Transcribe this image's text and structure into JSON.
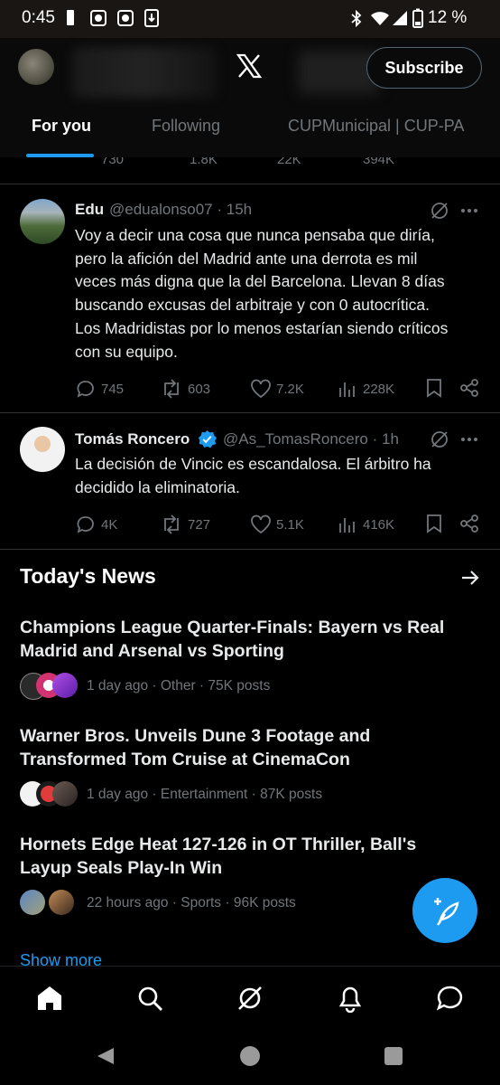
{
  "status_bar": {
    "time": "0:45",
    "battery": "12 %"
  },
  "header": {
    "logo": "x-logo-icon",
    "subscribe_label": "Subscribe"
  },
  "tabs": [
    {
      "label": "For you"
    },
    {
      "label": "Following"
    },
    {
      "label": "CUPMunicipal | CUP-PA"
    }
  ],
  "partial_row": {
    "replies": "730",
    "reposts": "1.8K",
    "likes": "22K",
    "views": "394K"
  },
  "tweets": [
    {
      "name": "Edu",
      "handle": "@edualonso07",
      "time": "· 15h",
      "verified": false,
      "lines": [
        "Voy a decir una cosa que nunca pensaba que diría,",
        "pero la afición del Madrid ante una derrota es mil",
        "veces más digna que la del Barcelona. Llevan 8 días",
        "buscando excusas del arbitraje y con 0 autocrítica.",
        "Los Madridistas por lo menos estarían siendo críticos",
        "con su equipo."
      ],
      "replies": "745",
      "reposts": "603",
      "likes": "7.2K",
      "views": "228K"
    },
    {
      "name": "Tomás Roncero",
      "handle": "@As_TomasRoncero",
      "time": "· 1h",
      "verified": true,
      "lines": [
        "La decisión de Vincic es escandalosa. El árbitro ha",
        "decidido la eliminatoria."
      ],
      "replies": "4K",
      "reposts": "727",
      "likes": "5.1K",
      "views": "416K"
    }
  ],
  "news": {
    "heading": "Today's News",
    "items": [
      {
        "title_lines": [
          "Champions League Quarter-Finals: Bayern vs Real",
          "Madrid and Arsenal vs Sporting"
        ],
        "meta": "1 day ago · Other · 75K posts"
      },
      {
        "title_lines": [
          "Warner Bros. Unveils Dune 3 Footage and",
          "Transformed Tom Cruise at CinemaCon"
        ],
        "meta": "1 day ago · Entertainment · 87K posts"
      },
      {
        "title_lines": [
          "Hornets Edge Heat 127-126 in OT Thriller, Ball's",
          "Layup Seals Play-In Win"
        ],
        "meta": "22 hours ago · Sports · 96K posts"
      }
    ],
    "show_more": "Show more"
  },
  "colors": {
    "accent": "#1d9bf0",
    "background": "#000000",
    "muted": "#71767b"
  },
  "icons": {
    "bottom_nav": [
      "home-icon",
      "search-icon",
      "grok-icon",
      "notifications-icon",
      "messages-icon"
    ],
    "system_nav": [
      "back-icon",
      "home-circle-icon",
      "recents-icon"
    ]
  }
}
